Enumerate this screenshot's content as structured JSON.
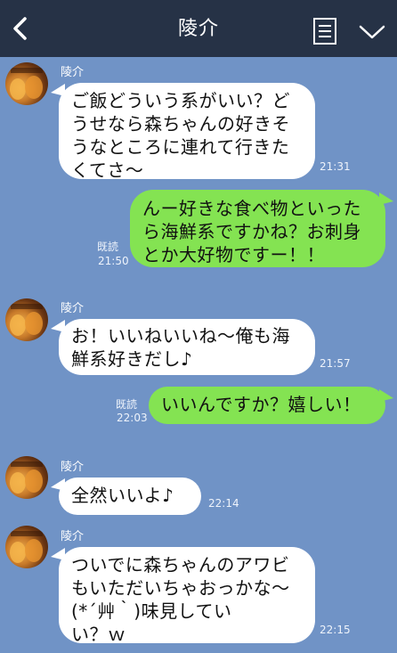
{
  "header": {
    "title": "陵介",
    "back_icon": "chevron-left-icon",
    "memo_icon": "note-icon",
    "menu_icon": "chevron-down-icon",
    "bg_color": "#263246"
  },
  "chat_bg_color": "#7093c6",
  "messages": [
    {
      "side": "left",
      "sender": "陵介",
      "lines": [
        "ご飯どういう系がいい？ど",
        "うせなら森ちゃんの好きそ",
        "うなところに連れて行きた",
        "くてさ〜"
      ],
      "time": "21:31"
    },
    {
      "side": "right",
      "lines": [
        "んー好きな食べ物といった",
        "ら海鮮系ですかね？お刺身",
        "とか大好物ですー！！"
      ],
      "read": "既読",
      "time": "21:50"
    },
    {
      "side": "left",
      "sender": "陵介",
      "lines": [
        "お！いいねいいね〜俺も海",
        "鮮系好きだし♪"
      ],
      "time": "21:57"
    },
    {
      "side": "right",
      "lines": [
        "いいんですか？嬉しい！"
      ],
      "read": "既読",
      "time": "22:03"
    },
    {
      "side": "left",
      "sender": "陵介",
      "lines": [
        "全然いいよ♪"
      ],
      "time": "22:14"
    },
    {
      "side": "left",
      "sender": "陵介",
      "lines": [
        "ついでに森ちゃんのアワビ",
        "もいただいちゃおっかな〜",
        "(*´艸｀)味見してい",
        "い？ｗ"
      ],
      "time": "22:15"
    }
  ]
}
